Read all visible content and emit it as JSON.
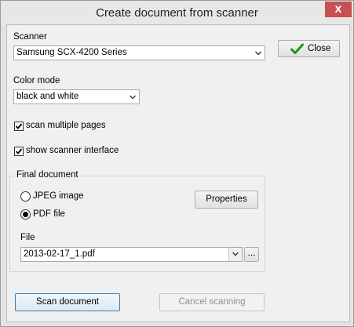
{
  "window": {
    "title": "Create document from scanner",
    "close_glyph": "x"
  },
  "scanner": {
    "label": "Scanner",
    "selected": "Samsung SCX-4200 Series"
  },
  "close_button": {
    "label": "Close",
    "icon": "check-icon"
  },
  "color_mode": {
    "label": "Color mode",
    "selected": "black and white"
  },
  "options": {
    "scan_multiple_pages": {
      "label": "scan multiple pages",
      "checked": true
    },
    "show_scanner_interface": {
      "label": "show scanner interface",
      "checked": true
    }
  },
  "final_document": {
    "label": "Final document",
    "jpeg": {
      "label": "JPEG image",
      "selected": false
    },
    "pdf": {
      "label": "PDF file",
      "selected": true
    },
    "properties_label": "Properties",
    "file_label": "File",
    "file_value": "2013-02-17_1.pdf",
    "browse_label": "..."
  },
  "buttons": {
    "scan": "Scan document",
    "cancel": "Cancel scanning"
  },
  "colors": {
    "close_x_bg": "#c75050",
    "check_green": "#1a9b1a"
  }
}
